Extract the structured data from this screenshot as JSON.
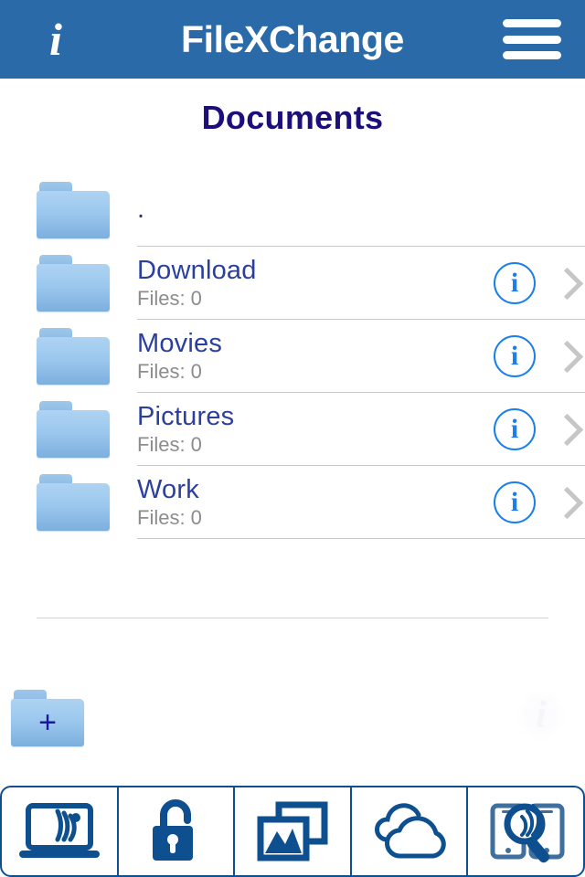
{
  "header": {
    "info_icon": "i",
    "title": "FileXChange",
    "menu_icon": "hamburger-menu-icon"
  },
  "page": {
    "title": "Documents"
  },
  "file_list": {
    "rows": [
      {
        "name": ".",
        "sub": "",
        "has_info": false,
        "has_chevron": false
      },
      {
        "name": "Download",
        "sub": "Files: 0",
        "has_info": true,
        "has_chevron": true
      },
      {
        "name": "Movies",
        "sub": "Files: 0",
        "has_info": true,
        "has_chevron": true
      },
      {
        "name": "Pictures",
        "sub": "Files: 0",
        "has_info": true,
        "has_chevron": true
      },
      {
        "name": "Work",
        "sub": "Files: 0",
        "has_info": true,
        "has_chevron": true
      }
    ],
    "info_glyph": "i"
  },
  "actions": {
    "new_folder_label": "+",
    "faded_info_label": "i"
  },
  "toolbar": {
    "buttons": [
      {
        "icon": "laptop-wifi-icon"
      },
      {
        "icon": "unlocked-padlock-icon"
      },
      {
        "icon": "gallery-images-icon"
      },
      {
        "icon": "clouds-icon"
      },
      {
        "icon": "device-discovery-icon"
      }
    ]
  },
  "colors": {
    "header_blue": "#2b6aa9",
    "title_navy": "#1d0f7a",
    "folder_name_blue": "#2b3f9e",
    "subtitle_gray": "#8c8c8c",
    "info_blue": "#1a80e8",
    "chevron_gray": "#c6c6c6",
    "toolbar_blue": "#0d4f8f",
    "folder_light": "#aed3f2",
    "folder_dark": "#7cafde"
  }
}
